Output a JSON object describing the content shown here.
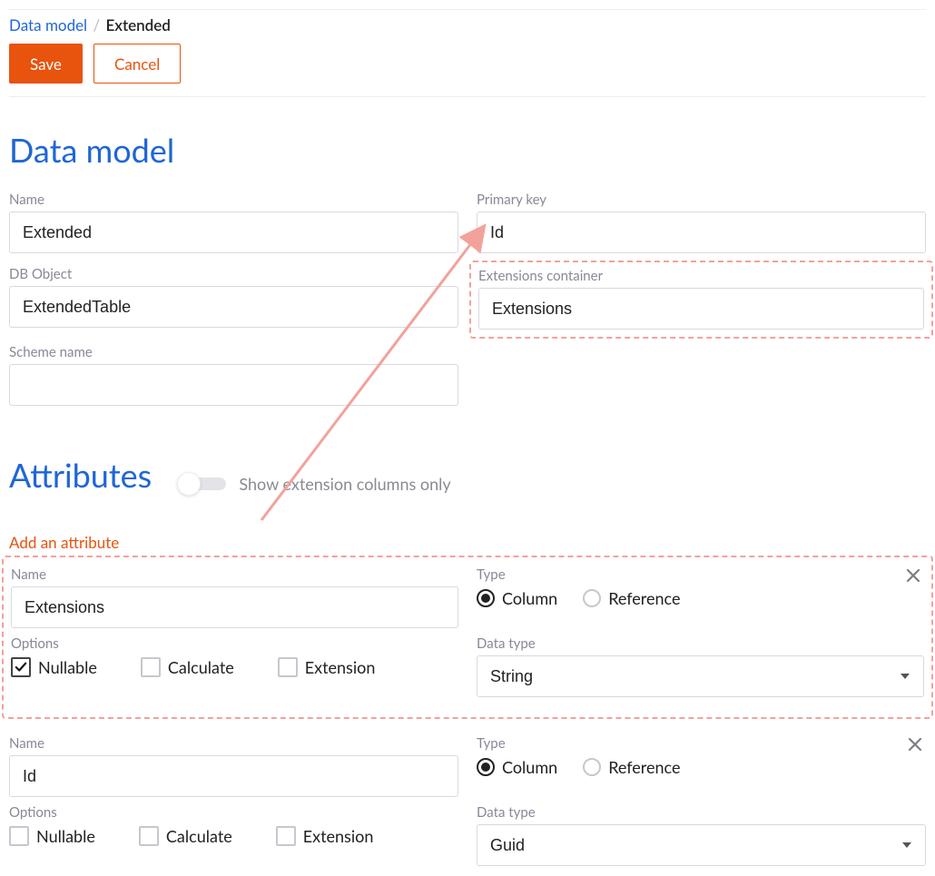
{
  "breadcrumb": {
    "root": "Data model",
    "current": "Extended"
  },
  "buttons": {
    "save": "Save",
    "cancel": "Cancel"
  },
  "section1": {
    "title": "Data model",
    "nameLabel": "Name",
    "nameValue": "Extended",
    "pkLabel": "Primary key",
    "pkValue": "Id",
    "dbObjLabel": "DB Object",
    "dbObjValue": "ExtendedTable",
    "extContainerLabel": "Extensions container",
    "extContainerValue": "Extensions",
    "schemeLabel": "Scheme name",
    "schemeValue": ""
  },
  "section2": {
    "title": "Attributes",
    "toggleLabel": "Show extension columns only",
    "addLink": "Add an attribute"
  },
  "labels": {
    "name": "Name",
    "type": "Type",
    "options": "Options",
    "dataType": "Data type",
    "nullable": "Nullable",
    "calculate": "Calculate",
    "extension": "Extension",
    "typeColumn": "Column",
    "typeReference": "Reference"
  },
  "attr1": {
    "name": "Extensions",
    "dataType": "String"
  },
  "attr2": {
    "name": "Id",
    "dataType": "Guid"
  }
}
